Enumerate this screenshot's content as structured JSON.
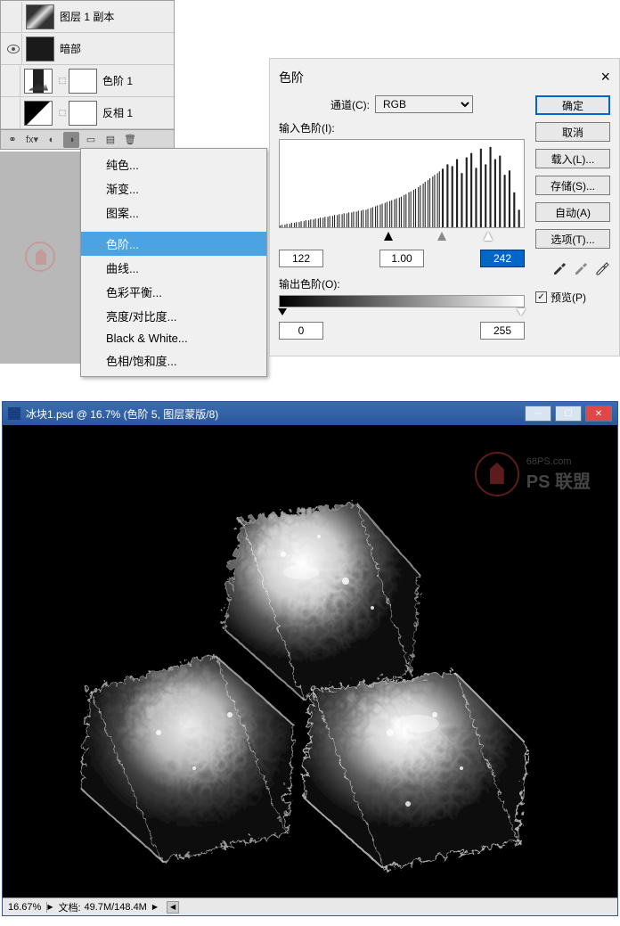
{
  "layers": {
    "row1_label": "图层 1 副本",
    "row2_label": "暗部",
    "row3_label": "色阶 1",
    "row4_label": "反相 1"
  },
  "menu": {
    "solid": "纯色...",
    "gradient": "渐变...",
    "pattern": "图案...",
    "levels": "色阶...",
    "curves": "曲线...",
    "color_balance": "色彩平衡...",
    "brightness": "亮度/对比度...",
    "bw": "Black & White...",
    "hue": "色相/饱和度..."
  },
  "levels_dialog": {
    "title": "色阶",
    "channel_label": "通道(C):",
    "channel_value": "RGB",
    "input_label": "输入色阶(I):",
    "output_label": "输出色阶(O):",
    "in_black": "122",
    "in_mid": "1.00",
    "in_white": "242",
    "out_black": "0",
    "out_white": "255",
    "btn_ok": "确定",
    "btn_cancel": "取消",
    "btn_load": "载入(L)...",
    "btn_save": "存储(S)...",
    "btn_auto": "自动(A)",
    "btn_options": "选项(T)...",
    "preview": "预览(P)"
  },
  "watermark": {
    "url": "68PS.com",
    "brand": "PS 联盟"
  },
  "img_window": {
    "title": "冰块1.psd @ 16.7% (色阶 5, 图层蒙版/8)",
    "zoom": "16.67%",
    "doc_label": "文档:",
    "doc_size": "49.7M/148.4M"
  }
}
